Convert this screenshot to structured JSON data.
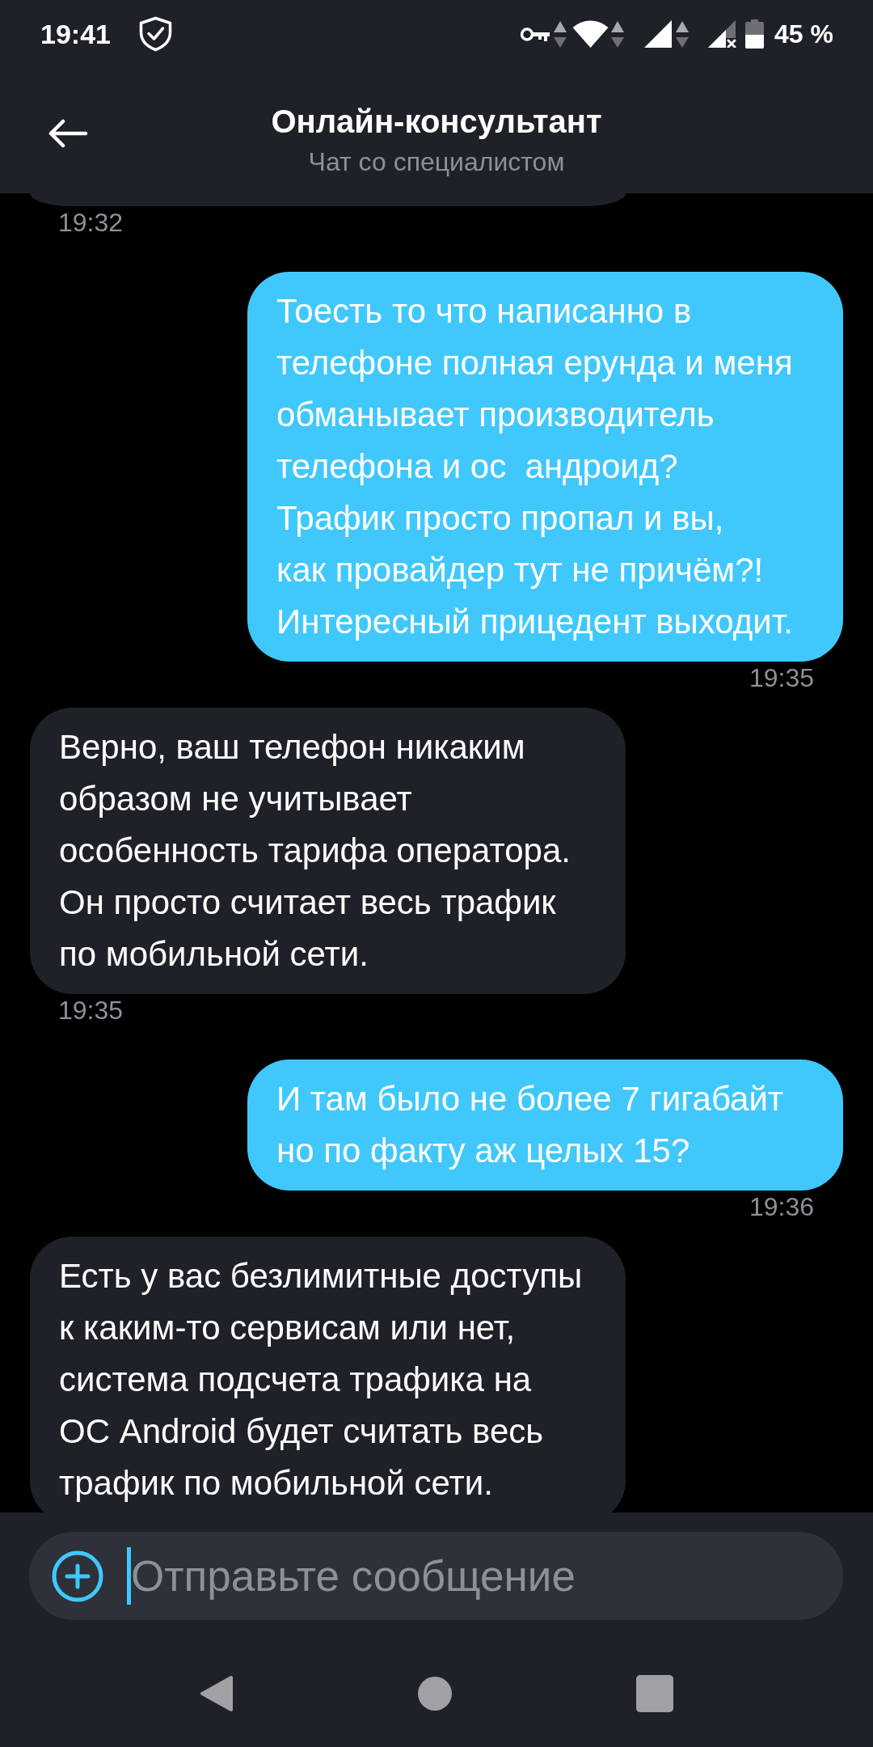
{
  "status_bar": {
    "time": "19:41",
    "battery": "45 %"
  },
  "header": {
    "title": "Онлайн-консультант",
    "subtitle": "Чат со специалистом"
  },
  "messages": [
    {
      "kind": "agent",
      "time": "19:32"
    },
    {
      "kind": "user",
      "text": "Тоесть то что написанно в\nтелефоне полная ерунда и меня\nобманывает производитель\nтелефона и ос  андроид?\nТрафик просто пропал и вы,\nкак провайдер тут не причём?!\nИнтересный прицедент выходит.",
      "time": "19:35"
    },
    {
      "kind": "agent",
      "text": "Верно, ваш телефон никаким\nобразом не учитывает\nособенность тарифа оператора.\nОн просто считает весь трафик\nпо мобильной сети.",
      "time": "19:35"
    },
    {
      "kind": "user",
      "text": "И там было не более 7 гигабайт\nно по факту аж целых 15?",
      "time": "19:36"
    },
    {
      "kind": "agent",
      "text": "Есть у вас безлимитные доступы\nк каким-то сервисам или нет,\nсистема подсчета трафика на\nОС Android будет считать весь\nтрафик по мобильной сети."
    }
  ],
  "composer": {
    "placeholder": "Отправьте сообщение",
    "focused": true
  }
}
